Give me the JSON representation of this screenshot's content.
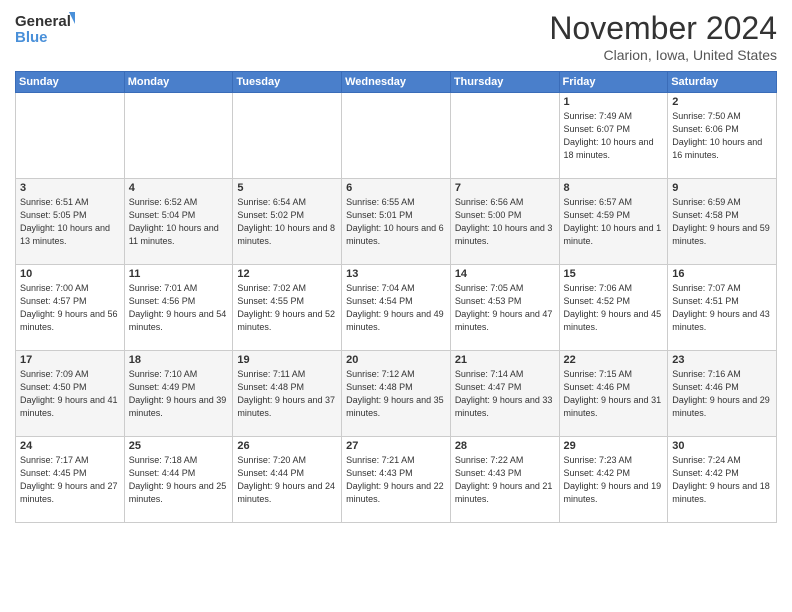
{
  "logo": {
    "line1": "General",
    "line2": "Blue"
  },
  "title": "November 2024",
  "location": "Clarion, Iowa, United States",
  "weekdays": [
    "Sunday",
    "Monday",
    "Tuesday",
    "Wednesday",
    "Thursday",
    "Friday",
    "Saturday"
  ],
  "weeks": [
    [
      {
        "day": "",
        "info": ""
      },
      {
        "day": "",
        "info": ""
      },
      {
        "day": "",
        "info": ""
      },
      {
        "day": "",
        "info": ""
      },
      {
        "day": "",
        "info": ""
      },
      {
        "day": "1",
        "info": "Sunrise: 7:49 AM\nSunset: 6:07 PM\nDaylight: 10 hours and 18 minutes."
      },
      {
        "day": "2",
        "info": "Sunrise: 7:50 AM\nSunset: 6:06 PM\nDaylight: 10 hours and 16 minutes."
      }
    ],
    [
      {
        "day": "3",
        "info": "Sunrise: 6:51 AM\nSunset: 5:05 PM\nDaylight: 10 hours and 13 minutes."
      },
      {
        "day": "4",
        "info": "Sunrise: 6:52 AM\nSunset: 5:04 PM\nDaylight: 10 hours and 11 minutes."
      },
      {
        "day": "5",
        "info": "Sunrise: 6:54 AM\nSunset: 5:02 PM\nDaylight: 10 hours and 8 minutes."
      },
      {
        "day": "6",
        "info": "Sunrise: 6:55 AM\nSunset: 5:01 PM\nDaylight: 10 hours and 6 minutes."
      },
      {
        "day": "7",
        "info": "Sunrise: 6:56 AM\nSunset: 5:00 PM\nDaylight: 10 hours and 3 minutes."
      },
      {
        "day": "8",
        "info": "Sunrise: 6:57 AM\nSunset: 4:59 PM\nDaylight: 10 hours and 1 minute."
      },
      {
        "day": "9",
        "info": "Sunrise: 6:59 AM\nSunset: 4:58 PM\nDaylight: 9 hours and 59 minutes."
      }
    ],
    [
      {
        "day": "10",
        "info": "Sunrise: 7:00 AM\nSunset: 4:57 PM\nDaylight: 9 hours and 56 minutes."
      },
      {
        "day": "11",
        "info": "Sunrise: 7:01 AM\nSunset: 4:56 PM\nDaylight: 9 hours and 54 minutes."
      },
      {
        "day": "12",
        "info": "Sunrise: 7:02 AM\nSunset: 4:55 PM\nDaylight: 9 hours and 52 minutes."
      },
      {
        "day": "13",
        "info": "Sunrise: 7:04 AM\nSunset: 4:54 PM\nDaylight: 9 hours and 49 minutes."
      },
      {
        "day": "14",
        "info": "Sunrise: 7:05 AM\nSunset: 4:53 PM\nDaylight: 9 hours and 47 minutes."
      },
      {
        "day": "15",
        "info": "Sunrise: 7:06 AM\nSunset: 4:52 PM\nDaylight: 9 hours and 45 minutes."
      },
      {
        "day": "16",
        "info": "Sunrise: 7:07 AM\nSunset: 4:51 PM\nDaylight: 9 hours and 43 minutes."
      }
    ],
    [
      {
        "day": "17",
        "info": "Sunrise: 7:09 AM\nSunset: 4:50 PM\nDaylight: 9 hours and 41 minutes."
      },
      {
        "day": "18",
        "info": "Sunrise: 7:10 AM\nSunset: 4:49 PM\nDaylight: 9 hours and 39 minutes."
      },
      {
        "day": "19",
        "info": "Sunrise: 7:11 AM\nSunset: 4:48 PM\nDaylight: 9 hours and 37 minutes."
      },
      {
        "day": "20",
        "info": "Sunrise: 7:12 AM\nSunset: 4:48 PM\nDaylight: 9 hours and 35 minutes."
      },
      {
        "day": "21",
        "info": "Sunrise: 7:14 AM\nSunset: 4:47 PM\nDaylight: 9 hours and 33 minutes."
      },
      {
        "day": "22",
        "info": "Sunrise: 7:15 AM\nSunset: 4:46 PM\nDaylight: 9 hours and 31 minutes."
      },
      {
        "day": "23",
        "info": "Sunrise: 7:16 AM\nSunset: 4:46 PM\nDaylight: 9 hours and 29 minutes."
      }
    ],
    [
      {
        "day": "24",
        "info": "Sunrise: 7:17 AM\nSunset: 4:45 PM\nDaylight: 9 hours and 27 minutes."
      },
      {
        "day": "25",
        "info": "Sunrise: 7:18 AM\nSunset: 4:44 PM\nDaylight: 9 hours and 25 minutes."
      },
      {
        "day": "26",
        "info": "Sunrise: 7:20 AM\nSunset: 4:44 PM\nDaylight: 9 hours and 24 minutes."
      },
      {
        "day": "27",
        "info": "Sunrise: 7:21 AM\nSunset: 4:43 PM\nDaylight: 9 hours and 22 minutes."
      },
      {
        "day": "28",
        "info": "Sunrise: 7:22 AM\nSunset: 4:43 PM\nDaylight: 9 hours and 21 minutes."
      },
      {
        "day": "29",
        "info": "Sunrise: 7:23 AM\nSunset: 4:42 PM\nDaylight: 9 hours and 19 minutes."
      },
      {
        "day": "30",
        "info": "Sunrise: 7:24 AM\nSunset: 4:42 PM\nDaylight: 9 hours and 18 minutes."
      }
    ]
  ]
}
